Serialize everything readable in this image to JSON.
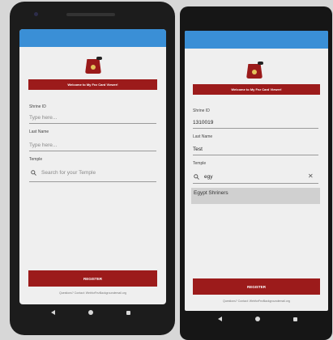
{
  "left": {
    "banner": "Welcome to My Fez Card Viewer!",
    "shrine_id": {
      "label": "Shrine ID",
      "placeholder": "Type here..."
    },
    "last_name": {
      "label": "Last Name",
      "placeholder": "Type here..."
    },
    "temple": {
      "label": "Temple",
      "placeholder": "Search for your Temple"
    },
    "register": "REGISTER",
    "footer": "Questions? Contact: WebforFezBackgroundemail.org"
  },
  "right": {
    "banner": "Welcome to My Fez Card Viewer!",
    "shrine_id": {
      "label": "Shrine ID",
      "value": "1310019"
    },
    "last_name": {
      "label": "Last Name",
      "value": "Test"
    },
    "temple": {
      "label": "Temple",
      "value": "egy"
    },
    "suggestions": [
      "Egypt Shriners"
    ],
    "register": "REGISTER",
    "footer": "Questions? Contact: WebforFezBackgroundemail.org"
  },
  "icons": {
    "search": "search-icon",
    "clear": "close-icon",
    "logo": "fez-logo-icon"
  },
  "colors": {
    "app_bar": "#3a8fd6",
    "brand_red": "#9c1b1b"
  }
}
